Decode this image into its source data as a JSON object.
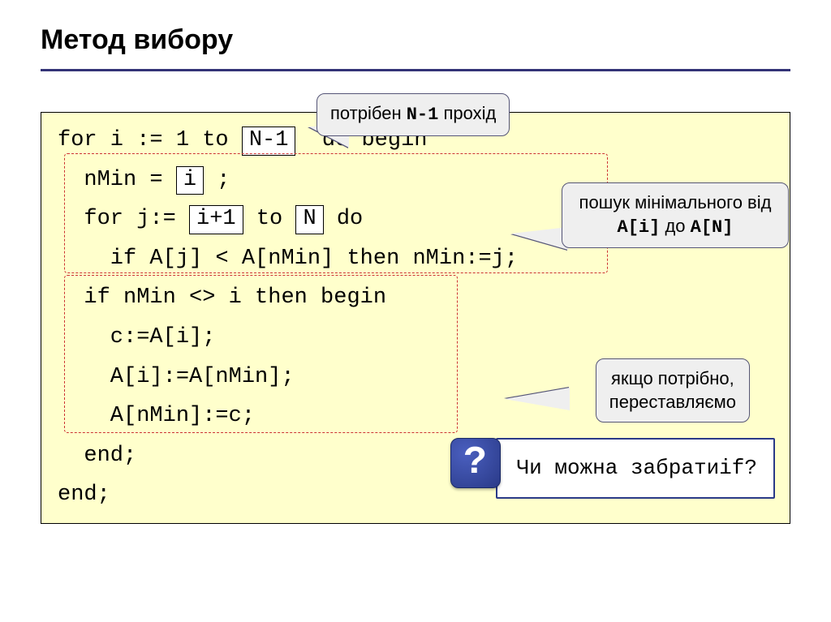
{
  "title": "Метод вибору",
  "callouts": {
    "top": {
      "pre": "потрібен ",
      "mono": "N-1",
      "post": " прохід"
    },
    "search": {
      "line1": "пошук мінімального від",
      "line2_a": "A[i]",
      "line2_mid": " до ",
      "line2_b": "A[N]"
    },
    "swap": {
      "line1": "якщо потрібно,",
      "line2": "переставляємо"
    }
  },
  "code": {
    "l1a": "for i := 1 to ",
    "l1_hl": "N-1",
    "l1b": "  do begin",
    "l2a": "  nMin = ",
    "l2_hl": "i",
    "l2b": " ;",
    "l3a": "  for j:= ",
    "l3_hl1": "i+1",
    "l3b": " to ",
    "l3_hl2": "N",
    "l3c": " do",
    "l4": "    if A[j] < A[nMin] then nMin:=j;",
    "l5": "  if nMin <> i then begin",
    "l6": "    c:=A[i];",
    "l7": "    A[i]:=A[nMin];",
    "l8": "    A[nMin]:=c;",
    "l9": "  end;",
    "l10": "end;"
  },
  "question": {
    "text_pre": "Чи можна забрати ",
    "mono": "if",
    "text_post": "?"
  }
}
